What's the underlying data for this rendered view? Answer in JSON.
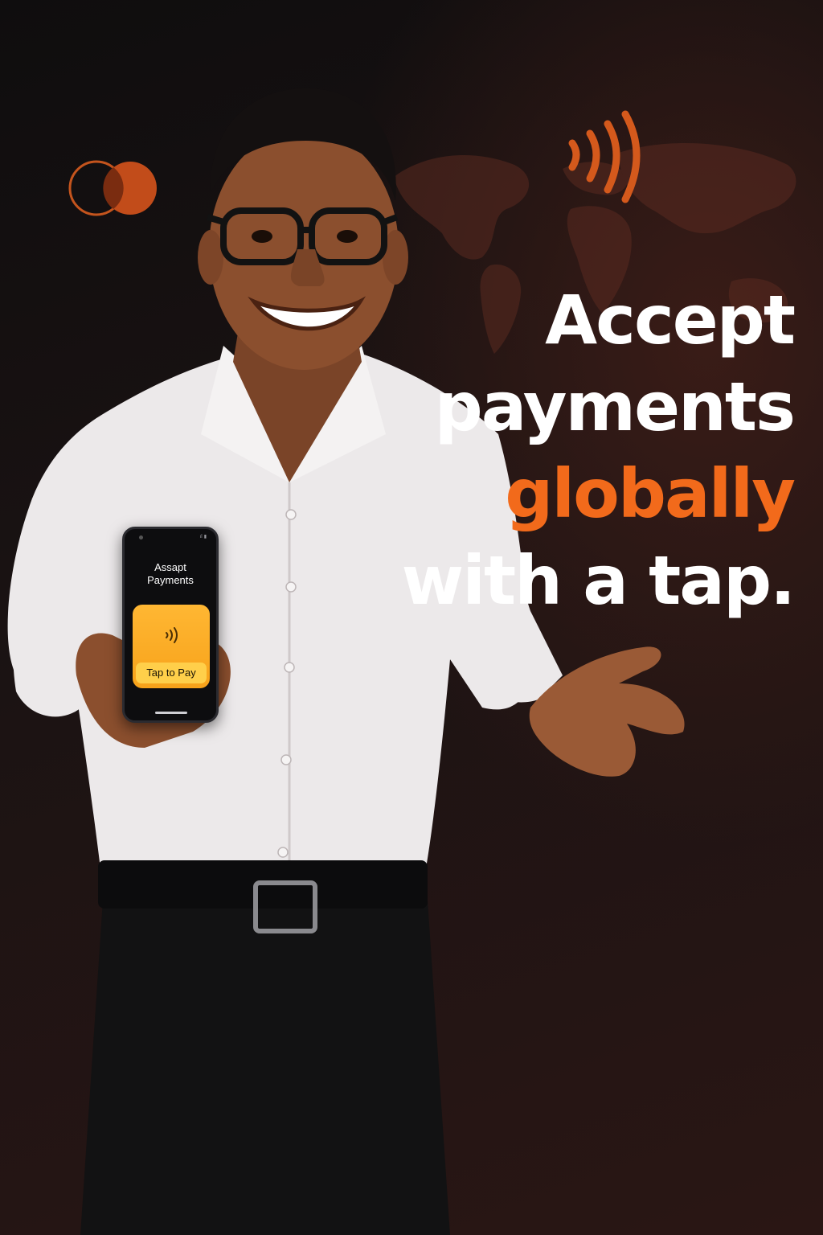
{
  "headline": {
    "line1": "Accept",
    "line2": "payments",
    "line3": "globally",
    "line4": "with a tap."
  },
  "phone": {
    "title_line1": "Assapt",
    "title_line2": "Payments",
    "button_label": "Tap to Pay",
    "status_text": "ıl ▮"
  },
  "colors": {
    "accent": "#f26a1b",
    "background": "#1b1313",
    "card": "#f7a21a",
    "button": "#ffcf4a"
  },
  "icons": {
    "brand": "overlapping-circles-logo",
    "contactless": "contactless-payment-icon",
    "map": "world-map"
  }
}
